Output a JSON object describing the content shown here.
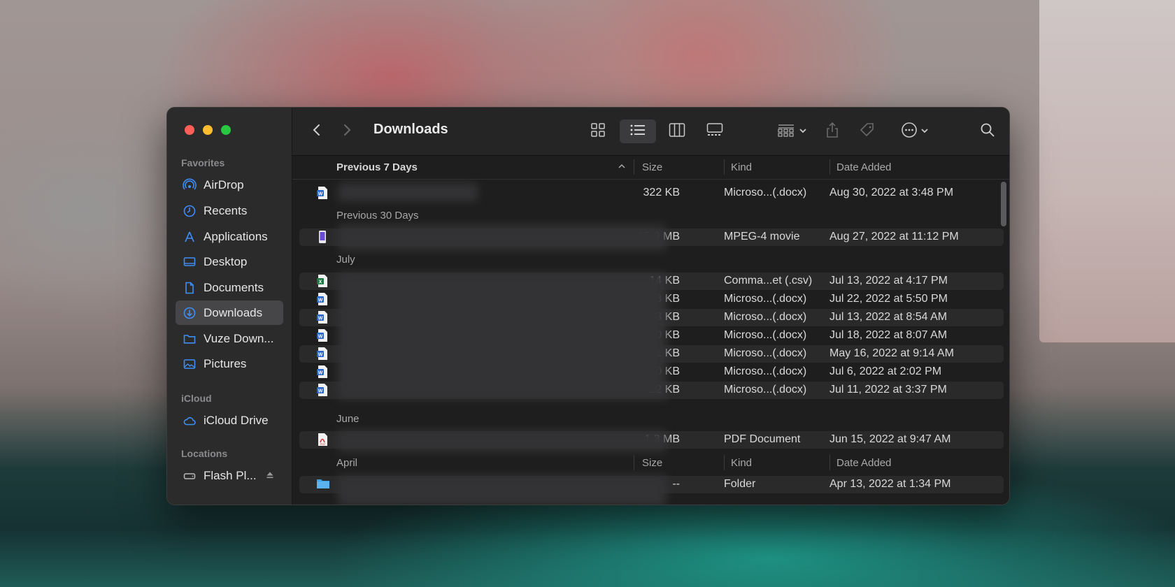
{
  "window": {
    "title": "Downloads"
  },
  "sidebar": {
    "favorites_title": "Favorites",
    "favorites": [
      {
        "label": "AirDrop",
        "icon": "airdrop-icon"
      },
      {
        "label": "Recents",
        "icon": "clock-icon"
      },
      {
        "label": "Applications",
        "icon": "applications-icon"
      },
      {
        "label": "Desktop",
        "icon": "desktop-icon"
      },
      {
        "label": "Documents",
        "icon": "document-icon"
      },
      {
        "label": "Downloads",
        "icon": "download-icon",
        "selected": true
      },
      {
        "label": "Vuze Down...",
        "icon": "folder-icon"
      },
      {
        "label": "Pictures",
        "icon": "photo-icon"
      }
    ],
    "icloud_title": "iCloud",
    "icloud": [
      {
        "label": "iCloud Drive",
        "icon": "cloud-icon"
      }
    ],
    "locations_title": "Locations",
    "locations": [
      {
        "label": "Flash Pl...",
        "icon": "drive-icon"
      }
    ]
  },
  "columns": {
    "name": "Previous 7 Days",
    "size": "Size",
    "kind": "Kind",
    "date": "Date Added"
  },
  "groups": {
    "previous_30": "Previous 30 Days",
    "july": "July",
    "june": "June"
  },
  "april_header": {
    "name": "April",
    "size": "Size",
    "kind": "Kind",
    "date": "Date Added"
  },
  "rows": {
    "r1": {
      "icon": "word-doc-icon",
      "name": "",
      "size": "322 KB",
      "kind": "Microso...(.docx)",
      "date": "Aug 30, 2022 at 3:48 PM"
    },
    "r2": {
      "icon": "movie-icon",
      "name": "",
      "size": "15.9 MB",
      "kind": "MPEG-4 movie",
      "date": "Aug 27, 2022 at 11:12 PM"
    },
    "r3": {
      "icon": "csv-icon",
      "name": "",
      "size": "14 KB",
      "kind": "Comma...et (.csv)",
      "date": "Jul 13, 2022 at 4:17 PM"
    },
    "r4": {
      "icon": "word-doc-icon",
      "name": "",
      "size": "33 KB",
      "kind": "Microso...(.docx)",
      "date": "Jul 22, 2022 at 5:50 PM"
    },
    "r5": {
      "icon": "word-doc-icon",
      "name": "",
      "size": "33 KB",
      "kind": "Microso...(.docx)",
      "date": "Jul 13, 2022 at 8:54 AM"
    },
    "r6": {
      "icon": "word-doc-icon",
      "name": "",
      "size": "40 KB",
      "kind": "Microso...(.docx)",
      "date": "Jul 18, 2022 at 8:07 AM"
    },
    "r7": {
      "icon": "word-doc-icon",
      "name": "",
      "size": "81 KB",
      "kind": "Microso...(.docx)",
      "date": "May 16, 2022 at 9:14 AM"
    },
    "r8": {
      "icon": "word-doc-icon",
      "name": "",
      "size": "50 KB",
      "kind": "Microso...(.docx)",
      "date": "Jul 6, 2022 at 2:02 PM"
    },
    "r9": {
      "icon": "word-doc-icon",
      "name": "",
      "size": "22 KB",
      "kind": "Microso...(.docx)",
      "date": "Jul 11, 2022 at 3:37 PM"
    },
    "r10": {
      "icon": "pdf-icon",
      "name": "",
      "size": "1.3 MB",
      "kind": "PDF Document",
      "date": "Jun 15, 2022 at 9:47 AM"
    },
    "r11": {
      "icon": "folder-icon",
      "name": "",
      "size": "--",
      "kind": "Folder",
      "date": "Apr 13, 2022 at 1:34 PM"
    }
  },
  "colors": {
    "accent": "#0a84ff",
    "close": "#ff5f57",
    "minimize": "#febc2e",
    "zoom": "#28c840"
  }
}
